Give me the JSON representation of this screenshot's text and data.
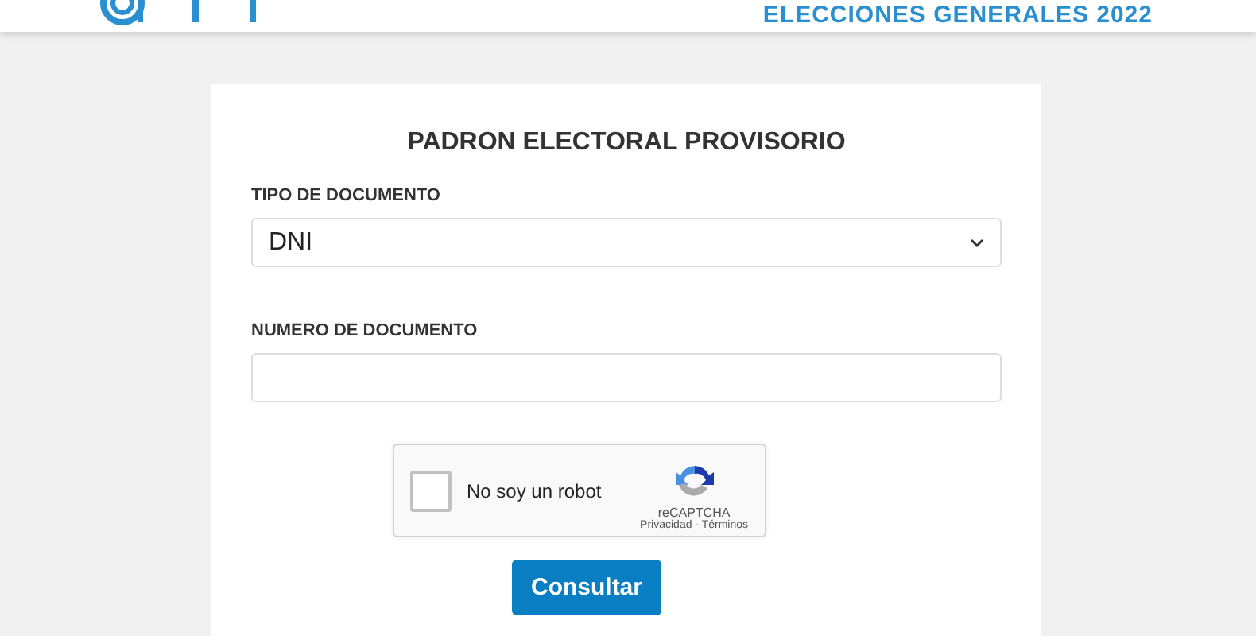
{
  "header": {
    "title": "ELECCIONES GENERALES 2022"
  },
  "form": {
    "title": "PADRON ELECTORAL PROVISORIO",
    "fields": [
      {
        "kind": "select",
        "label": "TIPO DE DOCUMENTO",
        "value": "DNI"
      },
      {
        "kind": "input",
        "label": "NUMERO DE DOCUMENTO"
      }
    ],
    "captcha": {
      "checked": false,
      "label": "No soy un robot",
      "brand": "reCAPTCHA",
      "links": "Privacidad - Términos"
    },
    "submit": "Consultar"
  }
}
